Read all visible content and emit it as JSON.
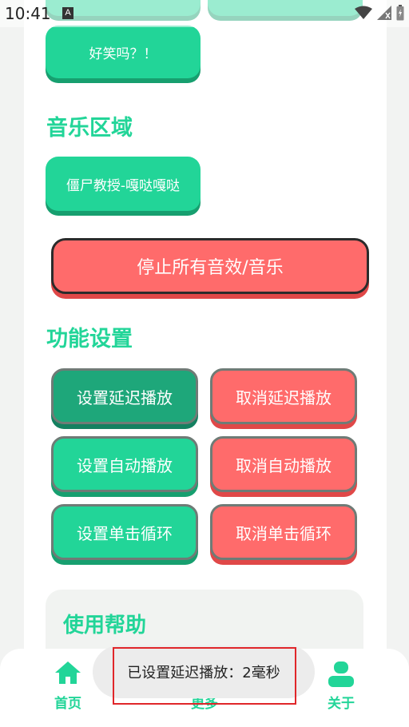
{
  "status_bar": {
    "time": "10:41",
    "notification_badge": "A"
  },
  "buttons": {
    "joke": "好笑吗？！",
    "music_track": "僵尸教授-嘎哒嘎哒",
    "stop_all": "停止所有音效/音乐",
    "set_delay": "设置延迟播放",
    "cancel_delay": "取消延迟播放",
    "set_autoplay": "设置自动播放",
    "cancel_autoplay": "取消自动播放",
    "set_loop": "设置单击循环",
    "cancel_loop": "取消单击循环"
  },
  "sections": {
    "music": "音乐区域",
    "settings": "功能设置",
    "help": "使用帮助"
  },
  "nav": {
    "home": "首页",
    "more": "更多",
    "about": "关于"
  },
  "toast": {
    "message": "已设置延迟播放：2毫秒"
  },
  "colors": {
    "accent": "#22d598",
    "danger": "#ff6b6b",
    "selected": "#1ea77a",
    "highlight_box": "#e0262a"
  }
}
